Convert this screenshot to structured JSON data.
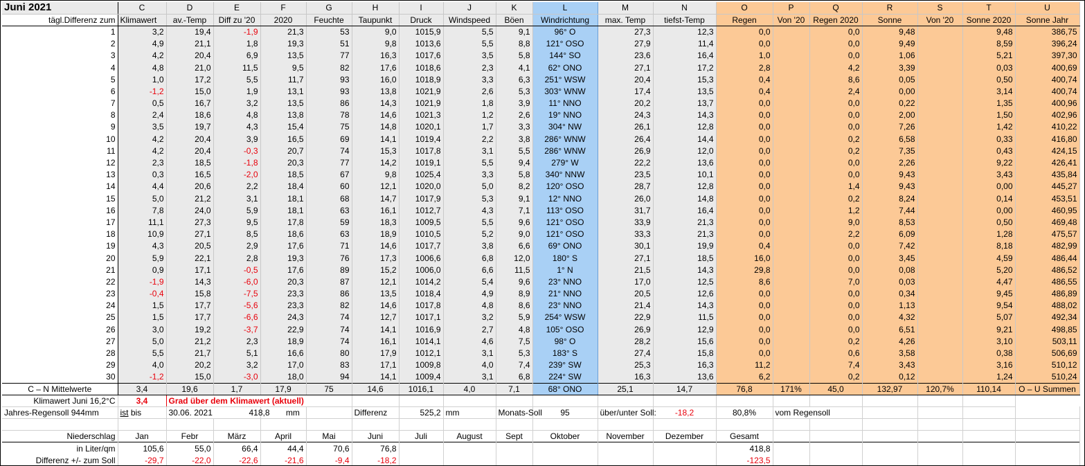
{
  "title": "Juni 2021",
  "column_letters": [
    "C",
    "D",
    "E",
    "F",
    "G",
    "H",
    "I",
    "J",
    "K",
    "L",
    "M",
    "N",
    "O",
    "P",
    "Q",
    "R",
    "S",
    "T",
    "U"
  ],
  "row_label_header": "tägl.Differenz zum",
  "column_headers": [
    "Klimawert",
    "av.-Temp",
    "Diff zu '20",
    "2020",
    "Feuchte",
    "Taupunkt",
    "Druck",
    "Windspeed",
    "Böen",
    "Windrichtung",
    "max. Temp",
    "tiefst-Temp",
    "Regen",
    "Von '20",
    "Regen 2020",
    "Sonne",
    "Von '20",
    "Sonne 2020",
    "Sonne Jahr"
  ],
  "colors": {
    "grey": "#eaeaea",
    "blue": "#a9d0f5",
    "orange": "#fcc996",
    "red_text": "#e8000b"
  },
  "rows": [
    {
      "day": "1",
      "c": "3,2",
      "d": "19,4",
      "e": "-1,9",
      "f": "21,3",
      "g": "53",
      "h": "9,0",
      "i": "1015,9",
      "j": "5,5",
      "k": "9,1",
      "l": "96° O",
      "m": "27,3",
      "n": "12,3",
      "o": "0,0",
      "p": "",
      "q": "0,0",
      "r": "9,48",
      "s": "",
      "t": "9,48",
      "u": "386,75"
    },
    {
      "day": "2",
      "c": "4,9",
      "d": "21,1",
      "e": "1,8",
      "f": "19,3",
      "g": "51",
      "h": "9,8",
      "i": "1013,6",
      "j": "5,5",
      "k": "8,8",
      "l": "121° OSO",
      "m": "27,9",
      "n": "11,4",
      "o": "0,0",
      "p": "",
      "q": "0,0",
      "r": "9,49",
      "s": "",
      "t": "8,59",
      "u": "396,24"
    },
    {
      "day": "3",
      "c": "4,2",
      "d": "20,4",
      "e": "6,9",
      "f": "13,5",
      "g": "77",
      "h": "16,3",
      "i": "1017,6",
      "j": "3,5",
      "k": "5,8",
      "l": "144° SO",
      "m": "23,6",
      "n": "16,4",
      "o": "1,0",
      "p": "",
      "q": "0,0",
      "r": "1,06",
      "s": "",
      "t": "5,21",
      "u": "397,30"
    },
    {
      "day": "4",
      "c": "4,8",
      "d": "21,0",
      "e": "11,5",
      "f": "9,5",
      "g": "82",
      "h": "17,6",
      "i": "1018,6",
      "j": "2,3",
      "k": "4,1",
      "l": "62° ONO",
      "m": "27,1",
      "n": "17,2",
      "o": "2,8",
      "p": "",
      "q": "4,2",
      "r": "3,39",
      "s": "",
      "t": "0,03",
      "u": "400,69"
    },
    {
      "day": "5",
      "c": "1,0",
      "d": "17,2",
      "e": "5,5",
      "f": "11,7",
      "g": "93",
      "h": "16,0",
      "i": "1018,9",
      "j": "3,3",
      "k": "6,3",
      "l": "251° WSW",
      "m": "20,4",
      "n": "15,3",
      "o": "0,4",
      "p": "",
      "q": "8,6",
      "r": "0,05",
      "s": "",
      "t": "0,50",
      "u": "400,74"
    },
    {
      "day": "6",
      "c": "-1,2",
      "d": "15,0",
      "e": "1,9",
      "f": "13,1",
      "g": "93",
      "h": "13,8",
      "i": "1021,9",
      "j": "2,6",
      "k": "5,3",
      "l": "303° WNW",
      "m": "17,4",
      "n": "13,5",
      "o": "0,4",
      "p": "",
      "q": "2,4",
      "r": "0,00",
      "s": "",
      "t": "3,14",
      "u": "400,74"
    },
    {
      "day": "7",
      "c": "0,5",
      "d": "16,7",
      "e": "3,2",
      "f": "13,5",
      "g": "86",
      "h": "14,3",
      "i": "1021,9",
      "j": "1,8",
      "k": "3,9",
      "l": "11° NNO",
      "m": "20,2",
      "n": "13,7",
      "o": "0,0",
      "p": "",
      "q": "0,0",
      "r": "0,22",
      "s": "",
      "t": "1,35",
      "u": "400,96"
    },
    {
      "day": "8",
      "c": "2,4",
      "d": "18,6",
      "e": "4,8",
      "f": "13,8",
      "g": "78",
      "h": "14,6",
      "i": "1021,3",
      "j": "1,2",
      "k": "2,6",
      "l": "19° NNO",
      "m": "24,3",
      "n": "14,3",
      "o": "0,0",
      "p": "",
      "q": "0,0",
      "r": "2,00",
      "s": "",
      "t": "1,50",
      "u": "402,96"
    },
    {
      "day": "9",
      "c": "3,5",
      "d": "19,7",
      "e": "4,3",
      "f": "15,4",
      "g": "75",
      "h": "14,8",
      "i": "1020,1",
      "j": "1,7",
      "k": "3,3",
      "l": "304° NW",
      "m": "26,1",
      "n": "12,8",
      "o": "0,0",
      "p": "",
      "q": "0,0",
      "r": "7,26",
      "s": "",
      "t": "1,42",
      "u": "410,22"
    },
    {
      "day": "10",
      "c": "4,2",
      "d": "20,4",
      "e": "3,9",
      "f": "16,5",
      "g": "69",
      "h": "14,1",
      "i": "1019,4",
      "j": "2,2",
      "k": "3,8",
      "l": "286° WNW",
      "m": "26,4",
      "n": "14,4",
      "o": "0,0",
      "p": "",
      "q": "0,2",
      "r": "6,58",
      "s": "",
      "t": "0,33",
      "u": "416,80"
    },
    {
      "day": "11",
      "c": "4,2",
      "d": "20,4",
      "e": "-0,3",
      "f": "20,7",
      "g": "74",
      "h": "15,3",
      "i": "1017,8",
      "j": "3,1",
      "k": "5,5",
      "l": "286° WNW",
      "m": "26,9",
      "n": "12,0",
      "o": "0,0",
      "p": "",
      "q": "0,2",
      "r": "7,35",
      "s": "",
      "t": "0,43",
      "u": "424,15"
    },
    {
      "day": "12",
      "c": "2,3",
      "d": "18,5",
      "e": "-1,8",
      "f": "20,3",
      "g": "77",
      "h": "14,2",
      "i": "1019,1",
      "j": "5,5",
      "k": "9,4",
      "l": "279° W",
      "m": "22,2",
      "n": "13,6",
      "o": "0,0",
      "p": "",
      "q": "0,0",
      "r": "2,26",
      "s": "",
      "t": "9,22",
      "u": "426,41"
    },
    {
      "day": "13",
      "c": "0,3",
      "d": "16,5",
      "e": "-2,0",
      "f": "18,5",
      "g": "67",
      "h": "9,8",
      "i": "1025,4",
      "j": "3,3",
      "k": "5,8",
      "l": "340° NNW",
      "m": "23,5",
      "n": "10,1",
      "o": "0,0",
      "p": "",
      "q": "0,0",
      "r": "9,43",
      "s": "",
      "t": "3,43",
      "u": "435,84"
    },
    {
      "day": "14",
      "c": "4,4",
      "d": "20,6",
      "e": "2,2",
      "f": "18,4",
      "g": "60",
      "h": "12,1",
      "i": "1020,0",
      "j": "5,0",
      "k": "8,2",
      "l": "120° OSO",
      "m": "28,7",
      "n": "12,8",
      "o": "0,0",
      "p": "",
      "q": "1,4",
      "r": "9,43",
      "s": "",
      "t": "0,00",
      "u": "445,27"
    },
    {
      "day": "15",
      "c": "5,0",
      "d": "21,2",
      "e": "3,1",
      "f": "18,1",
      "g": "68",
      "h": "14,7",
      "i": "1017,9",
      "j": "5,3",
      "k": "9,1",
      "l": "12° NNO",
      "m": "26,0",
      "n": "14,8",
      "o": "0,0",
      "p": "",
      "q": "0,2",
      "r": "8,24",
      "s": "",
      "t": "0,14",
      "u": "453,51"
    },
    {
      "day": "16",
      "c": "7,8",
      "d": "24,0",
      "e": "5,9",
      "f": "18,1",
      "g": "63",
      "h": "16,1",
      "i": "1012,7",
      "j": "4,3",
      "k": "7,1",
      "l": "113° OSO",
      "m": "31,7",
      "n": "16,4",
      "o": "0,0",
      "p": "",
      "q": "1,2",
      "r": "7,44",
      "s": "",
      "t": "0,00",
      "u": "460,95"
    },
    {
      "day": "17",
      "c": "11,1",
      "d": "27,3",
      "e": "9,5",
      "f": "17,8",
      "g": "59",
      "h": "18,3",
      "i": "1009,5",
      "j": "5,5",
      "k": "9,6",
      "l": "121° OSO",
      "m": "33,9",
      "n": "21,3",
      "o": "0,0",
      "p": "",
      "q": "9,0",
      "r": "8,53",
      "s": "",
      "t": "0,50",
      "u": "469,48"
    },
    {
      "day": "18",
      "c": "10,9",
      "d": "27,1",
      "e": "8,5",
      "f": "18,6",
      "g": "63",
      "h": "18,9",
      "i": "1010,5",
      "j": "5,2",
      "k": "9,0",
      "l": "121° OSO",
      "m": "33,3",
      "n": "21,3",
      "o": "0,0",
      "p": "",
      "q": "2,2",
      "r": "6,09",
      "s": "",
      "t": "1,28",
      "u": "475,57"
    },
    {
      "day": "19",
      "c": "4,3",
      "d": "20,5",
      "e": "2,9",
      "f": "17,6",
      "g": "71",
      "h": "14,6",
      "i": "1017,7",
      "j": "3,8",
      "k": "6,6",
      "l": "69° ONO",
      "m": "30,1",
      "n": "19,9",
      "o": "0,4",
      "p": "",
      "q": "0,0",
      "r": "7,42",
      "s": "",
      "t": "8,18",
      "u": "482,99"
    },
    {
      "day": "20",
      "c": "5,9",
      "d": "22,1",
      "e": "2,8",
      "f": "19,3",
      "g": "76",
      "h": "17,3",
      "i": "1006,6",
      "j": "6,8",
      "k": "12,0",
      "l": "180° S",
      "m": "27,1",
      "n": "18,5",
      "o": "16,0",
      "p": "",
      "q": "0,0",
      "r": "3,45",
      "s": "",
      "t": "4,59",
      "u": "486,44"
    },
    {
      "day": "21",
      "c": "0,9",
      "d": "17,1",
      "e": "-0,5",
      "f": "17,6",
      "g": "89",
      "h": "15,2",
      "i": "1006,0",
      "j": "6,6",
      "k": "11,5",
      "l": "1° N",
      "m": "21,5",
      "n": "14,3",
      "o": "29,8",
      "p": "",
      "q": "0,0",
      "r": "0,08",
      "s": "",
      "t": "5,20",
      "u": "486,52"
    },
    {
      "day": "22",
      "c": "-1,9",
      "d": "14,3",
      "e": "-6,0",
      "f": "20,3",
      "g": "87",
      "h": "12,1",
      "i": "1014,2",
      "j": "5,4",
      "k": "9,6",
      "l": "23° NNO",
      "m": "17,0",
      "n": "12,5",
      "o": "8,6",
      "p": "",
      "q": "7,0",
      "r": "0,03",
      "s": "",
      "t": "4,47",
      "u": "486,55"
    },
    {
      "day": "23",
      "c": "-0,4",
      "d": "15,8",
      "e": "-7,5",
      "f": "23,3",
      "g": "86",
      "h": "13,5",
      "i": "1018,4",
      "j": "4,9",
      "k": "8,9",
      "l": "21° NNO",
      "m": "20,5",
      "n": "12,6",
      "o": "0,0",
      "p": "",
      "q": "0,0",
      "r": "0,34",
      "s": "",
      "t": "9,45",
      "u": "486,89"
    },
    {
      "day": "24",
      "c": "1,5",
      "d": "17,7",
      "e": "-5,6",
      "f": "23,3",
      "g": "82",
      "h": "14,6",
      "i": "1017,8",
      "j": "4,8",
      "k": "8,6",
      "l": "23° NNO",
      "m": "21,4",
      "n": "14,3",
      "o": "0,0",
      "p": "",
      "q": "0,0",
      "r": "1,13",
      "s": "",
      "t": "9,54",
      "u": "488,02"
    },
    {
      "day": "25",
      "c": "1,5",
      "d": "17,7",
      "e": "-6,6",
      "f": "24,3",
      "g": "74",
      "h": "12,7",
      "i": "1017,1",
      "j": "3,2",
      "k": "5,9",
      "l": "254° WSW",
      "m": "22,9",
      "n": "11,5",
      "o": "0,0",
      "p": "",
      "q": "0,0",
      "r": "4,32",
      "s": "",
      "t": "5,07",
      "u": "492,34"
    },
    {
      "day": "26",
      "c": "3,0",
      "d": "19,2",
      "e": "-3,7",
      "f": "22,9",
      "g": "74",
      "h": "14,1",
      "i": "1016,9",
      "j": "2,7",
      "k": "4,8",
      "l": "105° OSO",
      "m": "26,9",
      "n": "12,9",
      "o": "0,0",
      "p": "",
      "q": "0,0",
      "r": "6,51",
      "s": "",
      "t": "9,21",
      "u": "498,85"
    },
    {
      "day": "27",
      "c": "5,0",
      "d": "21,2",
      "e": "2,3",
      "f": "18,9",
      "g": "74",
      "h": "16,1",
      "i": "1014,1",
      "j": "4,6",
      "k": "7,5",
      "l": "98° O",
      "m": "28,2",
      "n": "15,6",
      "o": "0,0",
      "p": "",
      "q": "0,2",
      "r": "4,26",
      "s": "",
      "t": "3,10",
      "u": "503,11"
    },
    {
      "day": "28",
      "c": "5,5",
      "d": "21,7",
      "e": "5,1",
      "f": "16,6",
      "g": "80",
      "h": "17,9",
      "i": "1012,1",
      "j": "3,1",
      "k": "5,3",
      "l": "183° S",
      "m": "27,4",
      "n": "15,8",
      "o": "0,0",
      "p": "",
      "q": "0,6",
      "r": "3,58",
      "s": "",
      "t": "0,38",
      "u": "506,69"
    },
    {
      "day": "29",
      "c": "4,0",
      "d": "20,2",
      "e": "3,2",
      "f": "17,0",
      "g": "83",
      "h": "17,1",
      "i": "1009,8",
      "j": "4,0",
      "k": "7,4",
      "l": "239° SW",
      "m": "25,3",
      "n": "16,3",
      "o": "11,2",
      "p": "",
      "q": "7,4",
      "r": "3,43",
      "s": "",
      "t": "3,16",
      "u": "510,12"
    },
    {
      "day": "30",
      "c": "-1,2",
      "d": "15,0",
      "e": "-3,0",
      "f": "18,0",
      "g": "94",
      "h": "14,1",
      "i": "1009,4",
      "j": "3,1",
      "k": "6,8",
      "l": "224° SW",
      "m": "16,3",
      "n": "13,6",
      "o": "6,2",
      "p": "",
      "q": "0,2",
      "r": "0,12",
      "s": "",
      "t": "1,24",
      "u": "510,24"
    }
  ],
  "summary": {
    "label": "C – N Mittelwerte",
    "c": "3,4",
    "d": "19,6",
    "e": "1,7",
    "f": "17,9",
    "g": "75",
    "h": "14,6",
    "i": "1016,1",
    "j": "4,0",
    "k": "7,1",
    "l": "68° ONO",
    "m": "25,1",
    "n": "14,7",
    "o": "76,8",
    "p": "171%",
    "q": "45,0",
    "r": "132,97",
    "s": "120,7%",
    "t": "110,14",
    "u": "O – U Summen"
  },
  "klimawert": {
    "label": "Klimawert Juni 16,2°C",
    "value": "3,4",
    "text": "Grad über dem Klimawert (aktuell)"
  },
  "jahres": {
    "label": "Jahres-Regensoll 944mm",
    "ist": "ist",
    "bis": "bis",
    "datum": "30.06. 2021",
    "wert": "418,8",
    "mm": "mm",
    "differenz_label": "Differenz",
    "differenz": "525,2",
    "mm2": "mm",
    "monats_soll_label": "Monats-Soll",
    "monats_soll": "95",
    "ueber_label": "über/unter Soll:",
    "ueber": "-18,2",
    "prozent": "80,8%",
    "vom": "vom Regensoll"
  },
  "niederschlag": {
    "label": "Niederschlag",
    "months": [
      "Jan",
      "Febr",
      "März",
      "April",
      "Mai",
      "Juni",
      "Juli",
      "August",
      "Sept",
      "Oktober",
      "November",
      "Dezember",
      "Gesamt"
    ],
    "liter_label": "in Liter/qm",
    "liter": [
      "105,6",
      "55,0",
      "66,4",
      "44,4",
      "70,6",
      "76,8",
      "",
      "",
      "",
      "",
      "",
      "",
      "418,8"
    ],
    "diff_label": "Differenz  +/- zum Soll",
    "diff": [
      "-29,7",
      "-22,0",
      "-22,6",
      "-21,6",
      "-9,4",
      "-18,2",
      "",
      "",
      "",
      "",
      "",
      "",
      "-123,5"
    ]
  }
}
